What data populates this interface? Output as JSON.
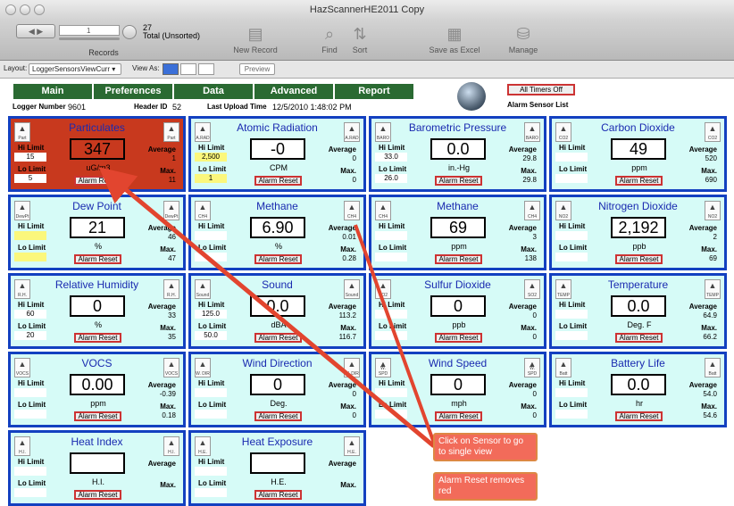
{
  "window": {
    "title": "HazScannerHE2011 Copy"
  },
  "toolbar": {
    "records_count": "27",
    "records_label": "Total (Unsorted)",
    "record_index": "1",
    "records_caption": "Records",
    "new_record": "New Record",
    "find": "Find",
    "sort": "Sort",
    "save_excel": "Save as Excel",
    "manage": "Manage"
  },
  "layoutbar": {
    "layout_label": "Layout:",
    "layout_value": "LoggerSensorsViewCurr",
    "view_as": "View As:",
    "preview": "Preview"
  },
  "nav": [
    "Main",
    "Preferences",
    "Data",
    "Advanced",
    "Report"
  ],
  "info": {
    "logger_label": "Logger Number",
    "logger_value": "9601",
    "header_label": "Header ID",
    "header_value": "52",
    "upload_label": "Last Upload Time",
    "upload_value": "12/5/2010 1:48:02 PM",
    "timers_button": "All Timers Off",
    "alarm_list": "Alarm Sensor List"
  },
  "common": {
    "hi_limit": "Hi Limit",
    "lo_limit": "Lo Limit",
    "average": "Average",
    "max": "Max.",
    "alarm_reset": "Alarm Reset"
  },
  "sensors": [
    {
      "name": "Particulates",
      "value": "347",
      "unit": "uG/m3",
      "hi": "15",
      "lo": "5",
      "avg": "1",
      "max": "11",
      "icon": "Part",
      "red": true
    },
    {
      "name": "Atomic Radiation",
      "value": "-0",
      "unit": "CPM",
      "hi": "2,500",
      "lo": "1",
      "avg": "0",
      "max": "0",
      "icon": "A.RAD",
      "yellow": true
    },
    {
      "name": "Barometric Pressure",
      "value": "0.0",
      "unit": "in.-Hg",
      "hi": "33.0",
      "lo": "26.0",
      "avg": "29.8",
      "max": "29.8",
      "icon": "BARO"
    },
    {
      "name": "Carbon Dioxide",
      "value": "49",
      "unit": "ppm",
      "hi": "",
      "lo": "",
      "avg": "520",
      "max": "690",
      "icon": "CO2"
    },
    {
      "name": "Dew Point",
      "value": "21",
      "unit": "%",
      "hi": "",
      "lo": "",
      "avg": "46",
      "max": "47",
      "icon": "DewPt",
      "yellow": true
    },
    {
      "name": "Methane",
      "value": "6.90",
      "unit": "%",
      "hi": "",
      "lo": "",
      "avg": "0.01",
      "max": "0.28",
      "icon": "CH4"
    },
    {
      "name": "Methane",
      "value": "69",
      "unit": "ppm",
      "hi": "",
      "lo": "",
      "avg": "3",
      "max": "138",
      "icon": "CH4"
    },
    {
      "name": "Nitrogen Dioxide",
      "value": "2,192",
      "unit": "ppb",
      "hi": "",
      "lo": "",
      "avg": "2",
      "max": "69",
      "icon": "NO2"
    },
    {
      "name": "Relative Humidity",
      "value": "0",
      "unit": "%",
      "hi": "60",
      "lo": "20",
      "avg": "33",
      "max": "35",
      "icon": "R.H."
    },
    {
      "name": "Sound",
      "value": "0.0",
      "unit": "dBA",
      "hi": "125.0",
      "lo": "50.0",
      "avg": "113.2",
      "max": "116.7",
      "icon": "Sound"
    },
    {
      "name": "Sulfur Dioxide",
      "value": "0",
      "unit": "ppb",
      "hi": "",
      "lo": "",
      "avg": "0",
      "max": "0",
      "icon": "SO2"
    },
    {
      "name": "Temperature",
      "value": "0.0",
      "unit": "Deg. F",
      "hi": "",
      "lo": "",
      "avg": "64.9",
      "max": "66.2",
      "icon": "TEMP"
    },
    {
      "name": "VOCS",
      "value": "0.00",
      "unit": "ppm",
      "hi": "",
      "lo": "",
      "avg": "-0.39",
      "max": "0.18",
      "icon": "VOCS"
    },
    {
      "name": "Wind Direction",
      "value": "0",
      "unit": "Deg.",
      "hi": "",
      "lo": "",
      "avg": "0",
      "max": "0",
      "icon": "W. DIR"
    },
    {
      "name": "Wind Speed",
      "value": "0",
      "unit": "mph",
      "hi": "",
      "lo": "",
      "avg": "0",
      "max": "0",
      "icon": "W. SPD"
    },
    {
      "name": "Battery Life",
      "value": "0.0",
      "unit": "hr",
      "hi": "",
      "lo": "",
      "avg": "54.0",
      "max": "54.6",
      "icon": "Batt"
    },
    {
      "name": "Heat Index",
      "value": "",
      "unit": "H.I.",
      "hi": "",
      "lo": "",
      "avg": "",
      "max": "",
      "icon": "H.I.",
      "no_avg_value": true
    },
    {
      "name": "Heat Exposure",
      "value": "",
      "unit": "H.E.",
      "hi": "",
      "lo": "",
      "avg": "",
      "max": "",
      "icon": "H.E.",
      "no_avg_value": true
    }
  ],
  "annotations": {
    "click_note": "Click on Sensor to go to single view",
    "reset_note": "Alarm Reset removes red"
  }
}
